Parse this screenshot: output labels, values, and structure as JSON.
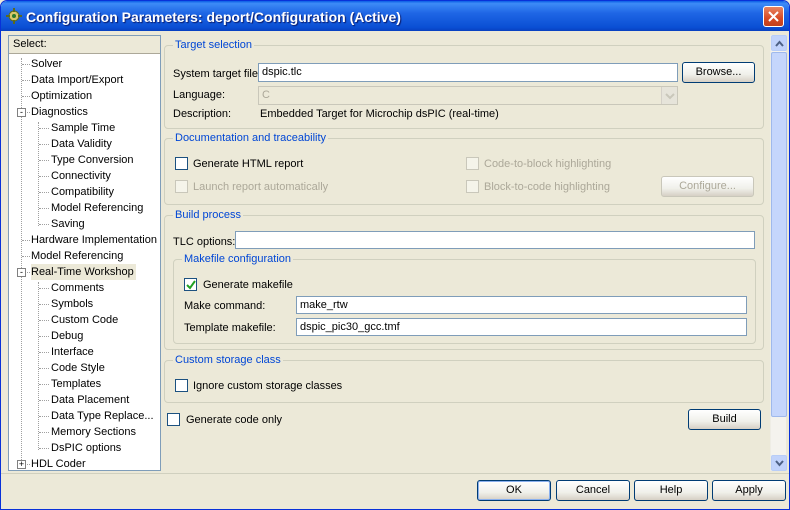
{
  "window": {
    "title": "Configuration Parameters: deport/Configuration (Active)"
  },
  "tree": {
    "header": "Select:",
    "items": [
      {
        "label": "Solver"
      },
      {
        "label": "Data Import/Export"
      },
      {
        "label": "Optimization"
      },
      {
        "label": "Diagnostics",
        "expander": "-"
      },
      {
        "label": "Sample Time"
      },
      {
        "label": "Data Validity"
      },
      {
        "label": "Type Conversion"
      },
      {
        "label": "Connectivity"
      },
      {
        "label": "Compatibility"
      },
      {
        "label": "Model Referencing"
      },
      {
        "label": "Saving"
      },
      {
        "label": "Hardware Implementation"
      },
      {
        "label": "Model Referencing"
      },
      {
        "label": "Real-Time Workshop",
        "expander": "-"
      },
      {
        "label": "Comments"
      },
      {
        "label": "Symbols"
      },
      {
        "label": "Custom Code"
      },
      {
        "label": "Debug"
      },
      {
        "label": "Interface"
      },
      {
        "label": "Code Style"
      },
      {
        "label": "Templates"
      },
      {
        "label": "Data Placement"
      },
      {
        "label": "Data Type Replace..."
      },
      {
        "label": "Memory Sections"
      },
      {
        "label": "DsPIC options"
      },
      {
        "label": "HDL Coder",
        "expander": "+"
      }
    ]
  },
  "target_selection": {
    "title": "Target selection",
    "system_target_file_label": "System target file:",
    "system_target_file_value": "dspic.tlc",
    "browse_label": "Browse...",
    "language_label": "Language:",
    "language_value": "C",
    "description_label": "Description:",
    "description_value": "Embedded Target for Microchip dsPIC (real-time)"
  },
  "documentation": {
    "title": "Documentation and traceability",
    "generate_html_report": {
      "label": "Generate HTML report",
      "checked": false
    },
    "launch_report": {
      "label": "Launch report automatically",
      "checked": false
    },
    "code_to_block": {
      "label": "Code-to-block highlighting",
      "checked": false
    },
    "block_to_code": {
      "label": "Block-to-code highlighting",
      "checked": false
    },
    "configure_label": "Configure..."
  },
  "build_process": {
    "title": "Build process",
    "tlc_options_label": "TLC options:",
    "tlc_options_value": "",
    "makefile": {
      "title": "Makefile configuration",
      "generate_makefile": {
        "label": "Generate makefile",
        "checked": true
      },
      "make_command_label": "Make command:",
      "make_command_value": "make_rtw",
      "template_makefile_label": "Template makefile:",
      "template_makefile_value": "dspic_pic30_gcc.tmf"
    }
  },
  "custom_storage": {
    "title": "Custom storage class",
    "ignore": {
      "label": "Ignore custom storage classes",
      "checked": false
    }
  },
  "generate_code_only": {
    "label": "Generate code only",
    "checked": false
  },
  "build_label": "Build",
  "buttons": {
    "ok": "OK",
    "cancel": "Cancel",
    "help": "Help",
    "apply": "Apply"
  },
  "colors": {
    "titlebar": "#0a4fd4",
    "group_title": "#0046d5",
    "checkmark": "#21a121"
  }
}
